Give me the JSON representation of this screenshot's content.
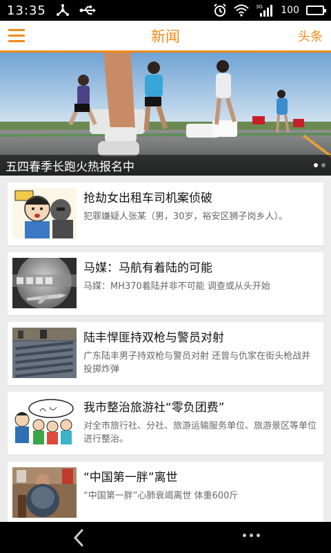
{
  "status_bar": {
    "time": "13:35",
    "network": "3G",
    "battery_label": "100",
    "icons": [
      "usb-share-icon",
      "usb-icon",
      "alarm-icon",
      "wifi-icon",
      "signal-icon",
      "battery-icon"
    ]
  },
  "header": {
    "menu_icon": "hamburger-menu-icon",
    "title": "新闻",
    "right_label": "头条"
  },
  "colors": {
    "accent": "#f08a19",
    "background": "#ececec",
    "title_text": "#111111",
    "summary_text": "#666666"
  },
  "hero": {
    "caption": "五四春季长跑火热报名中",
    "image": "marathon-runners-photo",
    "dots_total": 2,
    "active_dot": 1
  },
  "news": [
    {
      "title": "抢劫女出租车司机案侦破",
      "summary": "犯罪嫌疑人张某（男，30岁，裕安区狮子岗乡人）。",
      "thumb": "cartoon-robbery-thumbnail"
    },
    {
      "title": "马媒：马航有着陆的可能",
      "summary": "马媒：MH370着陆并非不可能 调查或从头开始",
      "thumb": "airplane-mystery-thumbnail"
    },
    {
      "title": "陆丰悍匪持双枪与警员对射",
      "summary": "广东陆丰男子持双枪与警员对射 还曾与仇家在街头枪战并投掷炸弹",
      "thumb": "seized-weapons-thumbnail"
    },
    {
      "title": "我市整治旅游社“零负团费”",
      "summary": "对全市旅行社、分社、旅游运输服务单位、旅游景区等单位进行整治。",
      "thumb": "cartoon-tour-group-thumbnail"
    },
    {
      "title": "“中国第一胖”离世",
      "summary": "“中国第一胖”心肺衰竭离世 体重600斤",
      "thumb": "heavy-man-photo-thumbnail"
    }
  ],
  "nav_bar": {
    "back_icon": "back-chevron-icon",
    "more_icon": "more-dots-icon"
  }
}
